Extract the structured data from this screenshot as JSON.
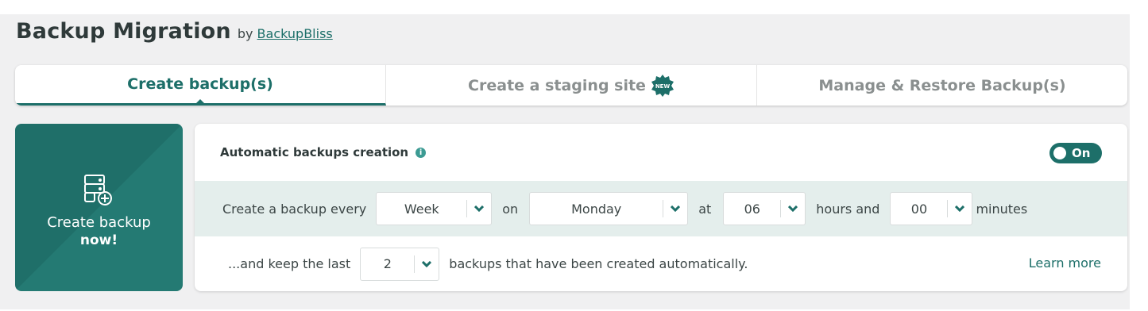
{
  "header": {
    "title": "Backup Migration",
    "by": "by",
    "author_link": "BackupBliss"
  },
  "tabs": [
    {
      "label": "Create backup(s)",
      "active": true
    },
    {
      "label": "Create a staging site",
      "badge": "NEW"
    },
    {
      "label": "Manage & Restore Backup(s)"
    }
  ],
  "create_button": {
    "line1": "Create backup",
    "line2": "now!",
    "icon": "server-add-icon"
  },
  "auto_backups": {
    "label": "Automatic backups creation",
    "info_icon": "i",
    "toggle_label": "On",
    "toggle_on": true
  },
  "schedule": {
    "prefix": "Create a backup every",
    "frequency": "Week",
    "on_text": "on",
    "day": "Monday",
    "at_text": "at",
    "hours": "06",
    "hours_text": "hours and",
    "minutes": "00",
    "minutes_text": "minutes"
  },
  "keep": {
    "prefix": "...and keep the last",
    "count": "2",
    "suffix": "backups that have been created automatically.",
    "learn_more": "Learn more"
  },
  "colors": {
    "accent": "#1d6f69",
    "row_highlight": "#e4eeec",
    "panel_bg": "#f0f0f1"
  }
}
